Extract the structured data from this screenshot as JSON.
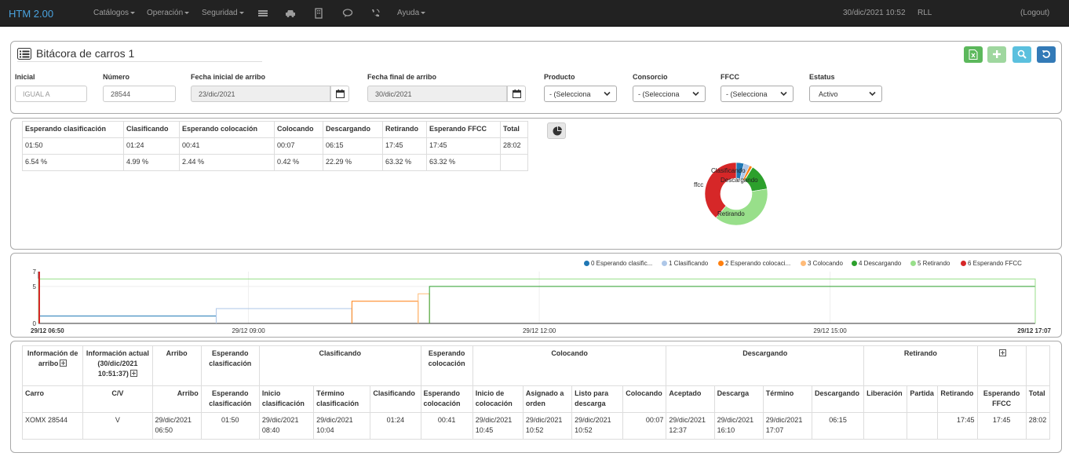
{
  "nav": {
    "brand": "HTM 2.00",
    "menus": [
      "Catálogos",
      "Operación",
      "Seguridad"
    ],
    "icons": [
      "list-icon",
      "car-icon",
      "building-icon",
      "chat-icon",
      "phone-icon"
    ],
    "help": "Ayuda",
    "datetime": "30/dic/2021 10:52",
    "user": "RLL",
    "logout": "(Logout)"
  },
  "filters": {
    "title": "Bitácora de carros 1",
    "inicial_label": "Inicial",
    "inicial_placeholder": "IGUAL A",
    "numero_label": "Número",
    "numero_value": "28544",
    "fecha_inicial_label": "Fecha inicial de arribo",
    "fecha_inicial_value": "23/dic/2021",
    "fecha_final_label": "Fecha final de arribo",
    "fecha_final_value": "30/dic/2021",
    "producto_label": "Producto",
    "producto_value": "- (Selecciona",
    "consorcio_label": "Consorcio",
    "consorcio_value": "- (Selecciona",
    "ffcc_label": "FFCC",
    "ffcc_value": "- (Selecciona",
    "estatus_label": "Estatus",
    "estatus_value": "Activo",
    "toolbar_colors": {
      "excel": "#5cb85c",
      "add": "#9fd79f",
      "search": "#5bc0de",
      "reset": "#337ab7"
    }
  },
  "summary": {
    "headers": [
      "Esperando clasificación",
      "Clasificando",
      "Esperando colocación",
      "Colocando",
      "Descargando",
      "Retirando",
      "Esperando FFCC",
      "Total"
    ],
    "times": [
      "01:50",
      "01:24",
      "00:41",
      "00:07",
      "06:15",
      "17:45",
      "17:45",
      "28:02"
    ],
    "percents": [
      "6.54 %",
      "4.99 %",
      "2.44 %",
      "0.42 %",
      "22.29 %",
      "63.32 %",
      "63.32 %",
      ""
    ]
  },
  "chart_data": [
    {
      "type": "pie",
      "title": "",
      "labels": [
        "Clasificando",
        "Descargando",
        "Retirando",
        "ffcc"
      ],
      "segments": [
        {
          "label": "Esperando clasificación",
          "value": 6.54,
          "color": "#1f77b4"
        },
        {
          "label": "Clasificando",
          "value": 4.99,
          "color": "#aec7e8"
        },
        {
          "label": "Esperando colocación",
          "value": 2.44,
          "color": "#ff7f0e"
        },
        {
          "label": "Colocando",
          "value": 0.42,
          "color": "#ffbb78"
        },
        {
          "label": "Descargando",
          "value": 22.29,
          "color": "#2ca02c"
        },
        {
          "label": "Retirando",
          "value": 63.32,
          "color": "#98df8a"
        },
        {
          "label": "Esperando FFCC",
          "value": 63.32,
          "color": "#d62728"
        }
      ]
    },
    {
      "type": "line",
      "title": "",
      "legend_placement": "top-right",
      "legend": [
        {
          "name": "0 Esperando clasific...",
          "color": "#1f77b4"
        },
        {
          "name": "1 Clasificando",
          "color": "#aec7e8"
        },
        {
          "name": "2 Esperando colocaci...",
          "color": "#ff7f0e"
        },
        {
          "name": "3 Colocando",
          "color": "#ffbb78"
        },
        {
          "name": "4 Descargando",
          "color": "#2ca02c"
        },
        {
          "name": "5 Retirando",
          "color": "#98df8a"
        },
        {
          "name": "6 Esperando FFCC",
          "color": "#d62728"
        }
      ],
      "x_ticks": [
        "29/12 06:50",
        "29/12 09:00",
        "29/12 12:00",
        "29/12 15:00",
        "29/12 17:07"
      ],
      "x_range_hours": [
        6.833,
        17.117
      ],
      "y_ticks": [
        "0",
        "5",
        "7"
      ],
      "ylim": [
        0,
        7
      ],
      "series": [
        {
          "name": "0 Esperando clasific...",
          "color": "#1f77b4",
          "start_hour": 6.833,
          "end_hour": 8.667,
          "level": 1
        },
        {
          "name": "1 Clasificando",
          "color": "#aec7e8",
          "start_hour": 8.667,
          "end_hour": 10.067,
          "level": 2
        },
        {
          "name": "2 Esperando colocaci...",
          "color": "#ff7f0e",
          "start_hour": 10.067,
          "end_hour": 10.75,
          "level": 3
        },
        {
          "name": "3 Colocando",
          "color": "#ffbb78",
          "start_hour": 10.75,
          "end_hour": 10.867,
          "level": 4
        },
        {
          "name": "4 Descargando",
          "color": "#2ca02c",
          "start_hour": 10.867,
          "end_hour": 17.117,
          "level": 5
        },
        {
          "name": "5 Retirando",
          "color": "#98df8a",
          "start_hour": 6.833,
          "end_hour": 17.117,
          "level": 6
        },
        {
          "name": "6 Esperando FFCC",
          "color": "#d62728",
          "start_hour": 6.833,
          "end_hour": 6.833,
          "level": 7
        }
      ]
    }
  ],
  "detail": {
    "group_headers": {
      "info_arribo": "Información de arribo",
      "info_actual": "Información actual (30/dic/2021 10:51:37)",
      "arribo": "Arribo",
      "esp_clasif": "Esperando clasificación",
      "clasificando": "Clasificando",
      "esp_coloc": "Esperando colocación",
      "colocando": "Colocando",
      "descargando": "Descargando",
      "retirando": "Retirando"
    },
    "columns": [
      "Carro",
      "C/V",
      "Arribo",
      "Esperando clasificación",
      "Inicio clasificación",
      "Término clasificación",
      "Clasificando",
      "Esperando colocación",
      "Inicio de colocación",
      "Asignado a orden",
      "Listo para descarga",
      "Colocando",
      "Aceptado",
      "Descarga",
      "Término",
      "Descargando",
      "Liberación",
      "Partida",
      "Retirando",
      "Esperando FFCC",
      "Total"
    ],
    "rows": [
      [
        "XOMX 28544",
        "V",
        "29/dic/2021 06:50",
        "01:50",
        "29/dic/2021 08:40",
        "29/dic/2021 10:04",
        "01:24",
        "00:41",
        "29/dic/2021 10:45",
        "29/dic/2021 10:52",
        "29/dic/2021 10:52",
        "00:07",
        "29/dic/2021 12:37",
        "29/dic/2021 16:10",
        "29/dic/2021 17:07",
        "06:15",
        "",
        "",
        "17:45",
        "17:45",
        "28:02"
      ]
    ]
  }
}
